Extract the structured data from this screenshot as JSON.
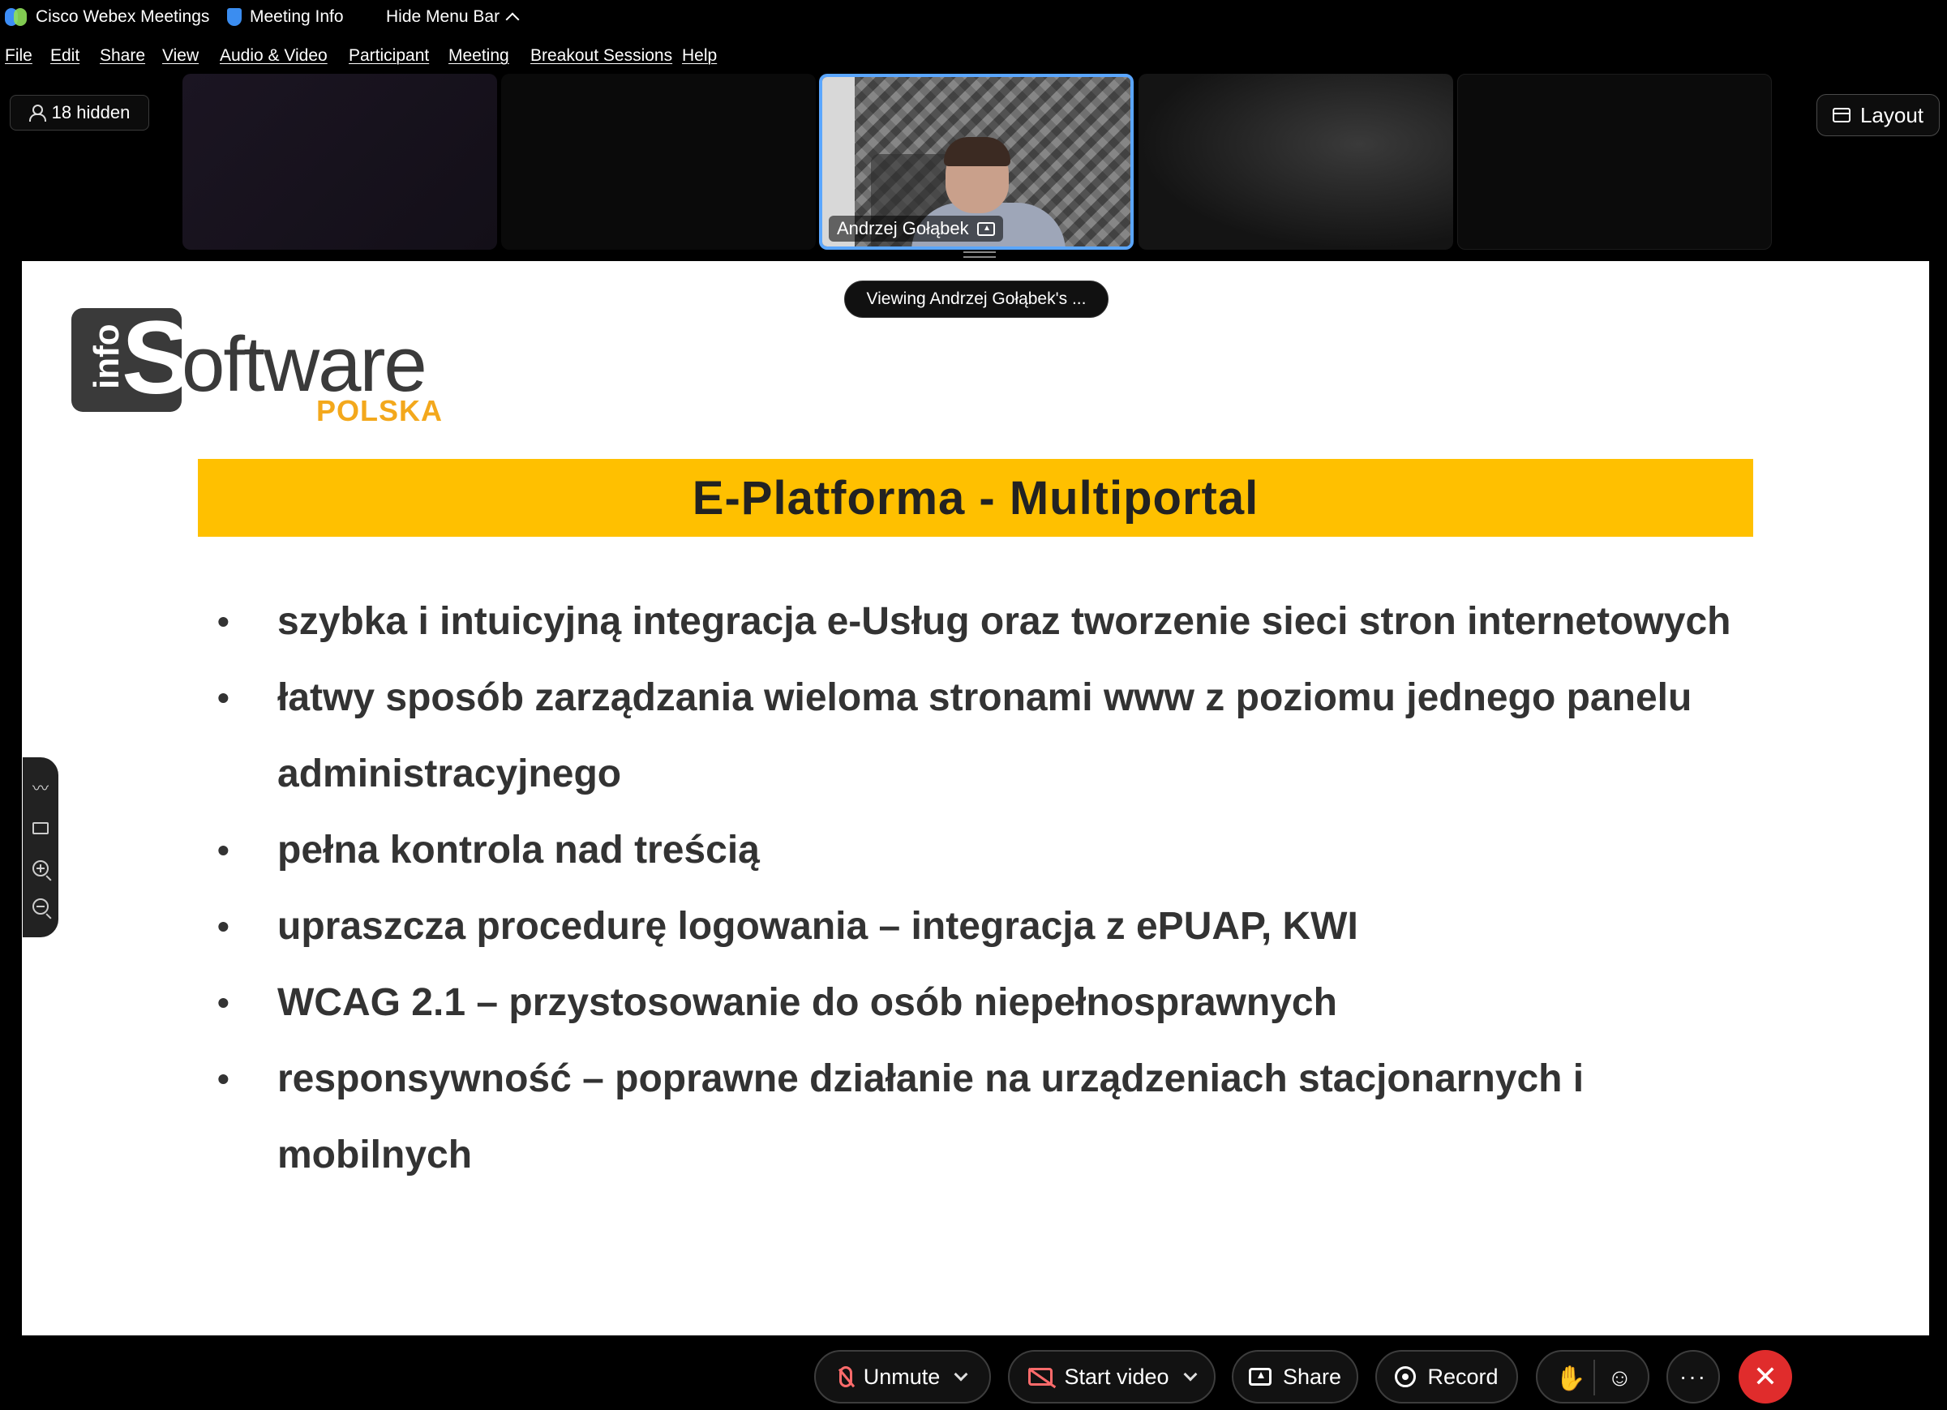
{
  "titlebar": {
    "app_name": "Cisco Webex Meetings",
    "meeting_info": "Meeting Info",
    "hide_menu": "Hide Menu Bar",
    "hide_menu_icon": "chevron-up-icon"
  },
  "menubar": {
    "items": [
      "File",
      "Edit",
      "Share",
      "View",
      "Audio & Video",
      "Participant",
      "Meeting",
      "Breakout Sessions",
      "Help"
    ]
  },
  "video_strip": {
    "hidden_label": "18 hidden",
    "active_participant": "Andrzej Gołąbek",
    "layout_label": "Layout"
  },
  "share": {
    "viewing_label": "Viewing Andrzej Gołąbek's ..."
  },
  "slide": {
    "logo_info": "info",
    "logo_s": "S",
    "logo_rest": "oftware",
    "logo_polska": "POLSKA",
    "title": "E-Platforma - Multiportal",
    "bullets": [
      "szybka i intuicyjną integracja e-Usług oraz tworzenie sieci stron internetowych",
      "łatwy sposób zarządzania wieloma stronami www z poziomu jednego panelu administracyjnego",
      "pełna kontrola nad treścią",
      "upraszcza procedurę logowania – integracja z ePUAP, KWI",
      "WCAG 2.1 – przystosowanie do osób niepełnosprawnych",
      "responsywność – poprawne działanie na urządzeniach stacjonarnych i mobilnych"
    ],
    "title_band_color": "#ffc000",
    "brand_orange": "#f3a81c"
  },
  "controls": {
    "unmute": "Unmute",
    "start_video": "Start video",
    "share": "Share",
    "record": "Record",
    "more": "···",
    "leave": "✕",
    "leave_color": "#e02c2c",
    "muted_color": "#ff6b6b"
  }
}
